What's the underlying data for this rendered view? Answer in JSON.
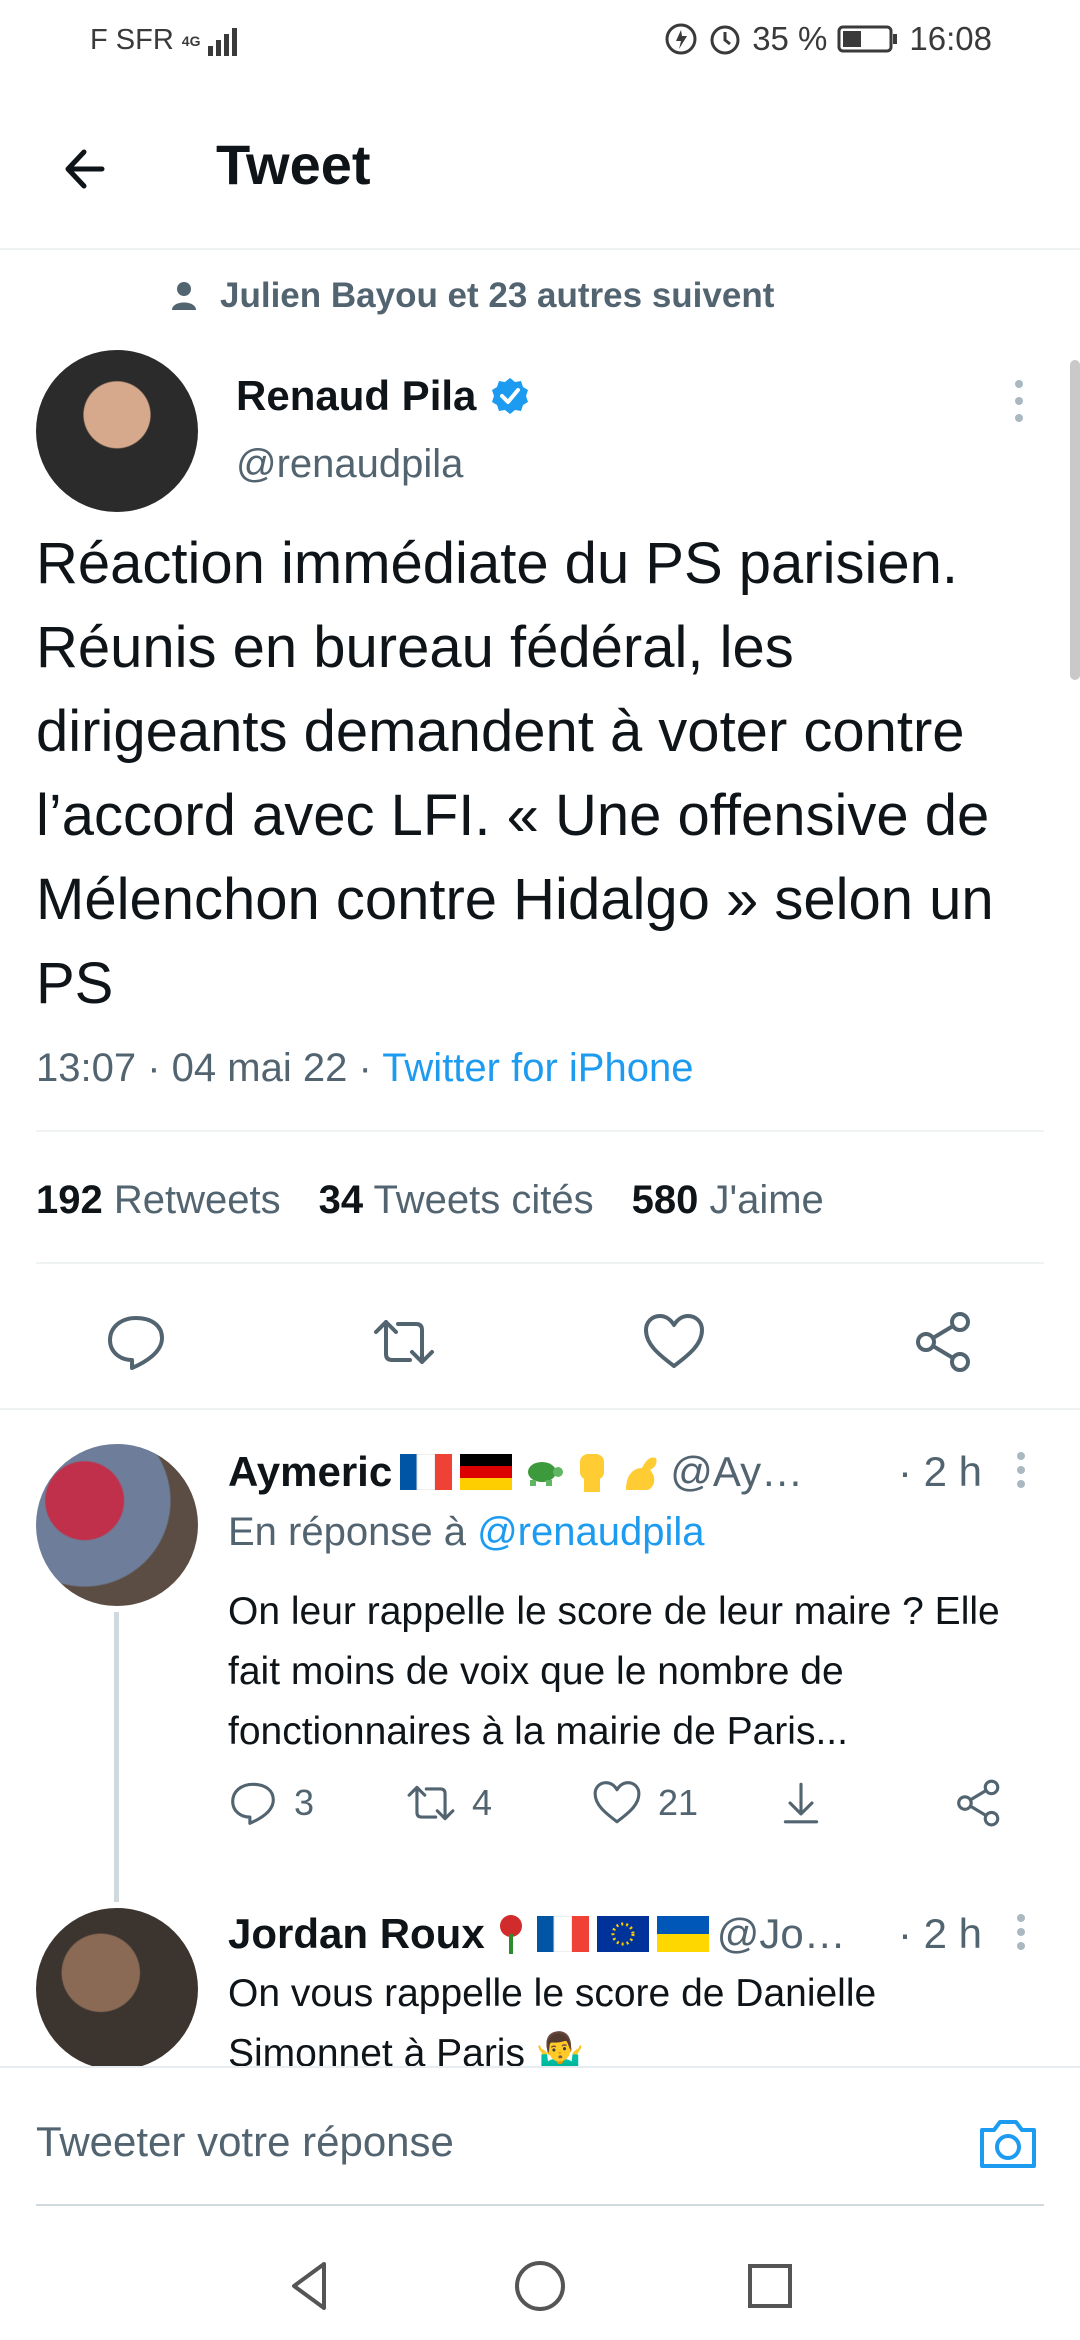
{
  "status_bar": {
    "carrier": "F SFR",
    "network": "4G",
    "battery": "35 %",
    "time": "16:08"
  },
  "header": {
    "title": "Tweet"
  },
  "tweet": {
    "social_context": "Julien Bayou et 23 autres suivent",
    "author_name": "Renaud Pila",
    "author_handle": "@renaudpila",
    "verified": true,
    "text": "Réaction immédiate du PS parisien. Réunis en bureau fédéral, les dirigeants demandent à voter contre l’accord avec LFI. « Une offensive de Mélenchon contre Hidalgo » selon un PS",
    "time": "13:07",
    "date": "04 mai 22",
    "source": "Twitter for iPhone",
    "stats": {
      "retweets_count": "192",
      "retweets_label": "Retweets",
      "quotes_count": "34",
      "quotes_label": "Tweets cités",
      "likes_count": "580",
      "likes_label": "J'aime"
    }
  },
  "replies": [
    {
      "name": "Aymeric",
      "handle": "@Ay…",
      "time": "· 2 h",
      "reply_to_prefix": "En réponse à",
      "reply_to_handle": "@renaudpila",
      "text": "On leur rappelle le score de leur maire ? Elle fait moins de voix que le nombre de fonctionnaires à la mairie de Paris...",
      "replies_count": "3",
      "retweets_count": "4",
      "likes_count": "21"
    },
    {
      "name": "Jordan Roux",
      "handle": "@Jo…",
      "time": "· 2 h",
      "text": "On vous rappelle le score de Danielle Simonnet à Paris 🤷‍♂️"
    }
  ],
  "compose": {
    "placeholder": "Tweeter votre réponse"
  },
  "colors": {
    "accent": "#1d9bf0",
    "text": "#0f1419",
    "secondary": "#536471"
  }
}
